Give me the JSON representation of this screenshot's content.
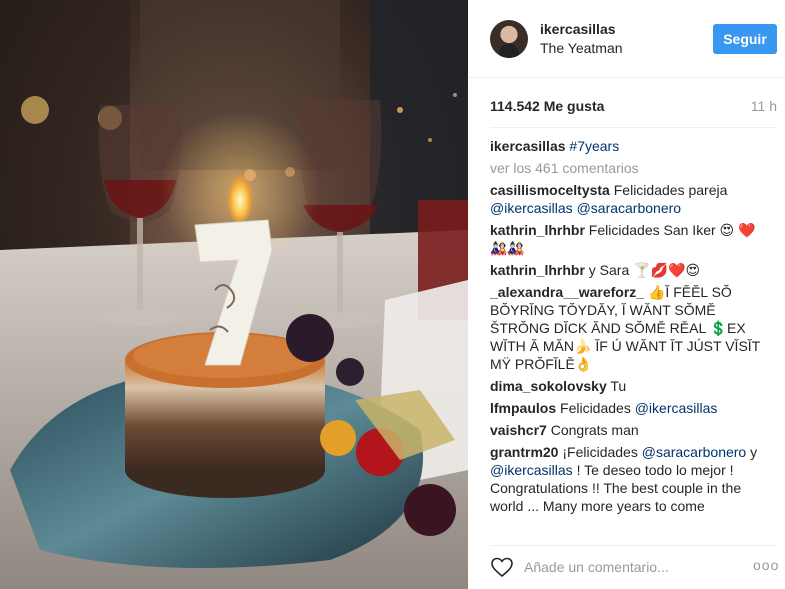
{
  "post": {
    "image_alt": "Birthday cake with number 7 candle",
    "candle_number": "7"
  },
  "header": {
    "username": "ikercasillas",
    "location": "The Yeatman",
    "follow_label": "Seguir"
  },
  "stats": {
    "likes": "114.542 Me gusta",
    "time": "11 h"
  },
  "caption": {
    "username": "ikercasillas",
    "text": "#7years"
  },
  "view_all": "ver los 461 comentarios",
  "comments": [
    {
      "user": "casillismoceltysta",
      "pre": "Felicidades pareja ",
      "mention1": "@ikercasillas",
      "mid": " ",
      "mention2": "@saracarbonero",
      "post": ""
    },
    {
      "user": "kathrin_lhrhbr",
      "pre": "Felicidades San Iker 😍 ❤️🎎🎎",
      "mention1": "",
      "mid": "",
      "mention2": "",
      "post": ""
    },
    {
      "user": "kathrin_lhrhbr",
      "pre": "y Sara 🍸💋❤️😍",
      "mention1": "",
      "mid": "",
      "mention2": "",
      "post": ""
    },
    {
      "user": "_alexandra__wareforz_",
      "pre": "👍Ĭ FĔĔL SŎ BŎYRĬNG TŎYDĂY, Ĭ WĂNT SŎMĔ ŠTRŎNG DĬCK ĂND SŎMĔ RĔAL 💲EX WĬTH Ă MĂN🍌 ĬF Ú WĂNT ĬT JÚST VĬSĬT MŸ PRŎFĬLĔ👌",
      "mention1": "",
      "mid": "",
      "mention2": "",
      "post": ""
    },
    {
      "user": "dima_sokolovsky",
      "pre": "Tu",
      "mention1": "",
      "mid": "",
      "mention2": "",
      "post": ""
    },
    {
      "user": "lfmpaulos",
      "pre": "Felicidades ",
      "mention1": "@ikercasillas",
      "mid": "",
      "mention2": "",
      "post": ""
    },
    {
      "user": "vaishcr7",
      "pre": "Congrats man",
      "mention1": "",
      "mid": "",
      "mention2": "",
      "post": ""
    },
    {
      "user": "grantrm20",
      "pre": "¡Felicidades ",
      "mention1": "@saracarbonero",
      "mid": " y ",
      "mention2": "@ikercasillas",
      "post": " ! Te deseo todo lo mejor ! Congratulations !! The best couple in the world ... Many more years to come"
    }
  ],
  "footer": {
    "placeholder": "Añade un comentario...",
    "more": "ooo"
  },
  "colors": {
    "accent": "#3897f0",
    "link": "#003569",
    "muted": "#999999"
  }
}
